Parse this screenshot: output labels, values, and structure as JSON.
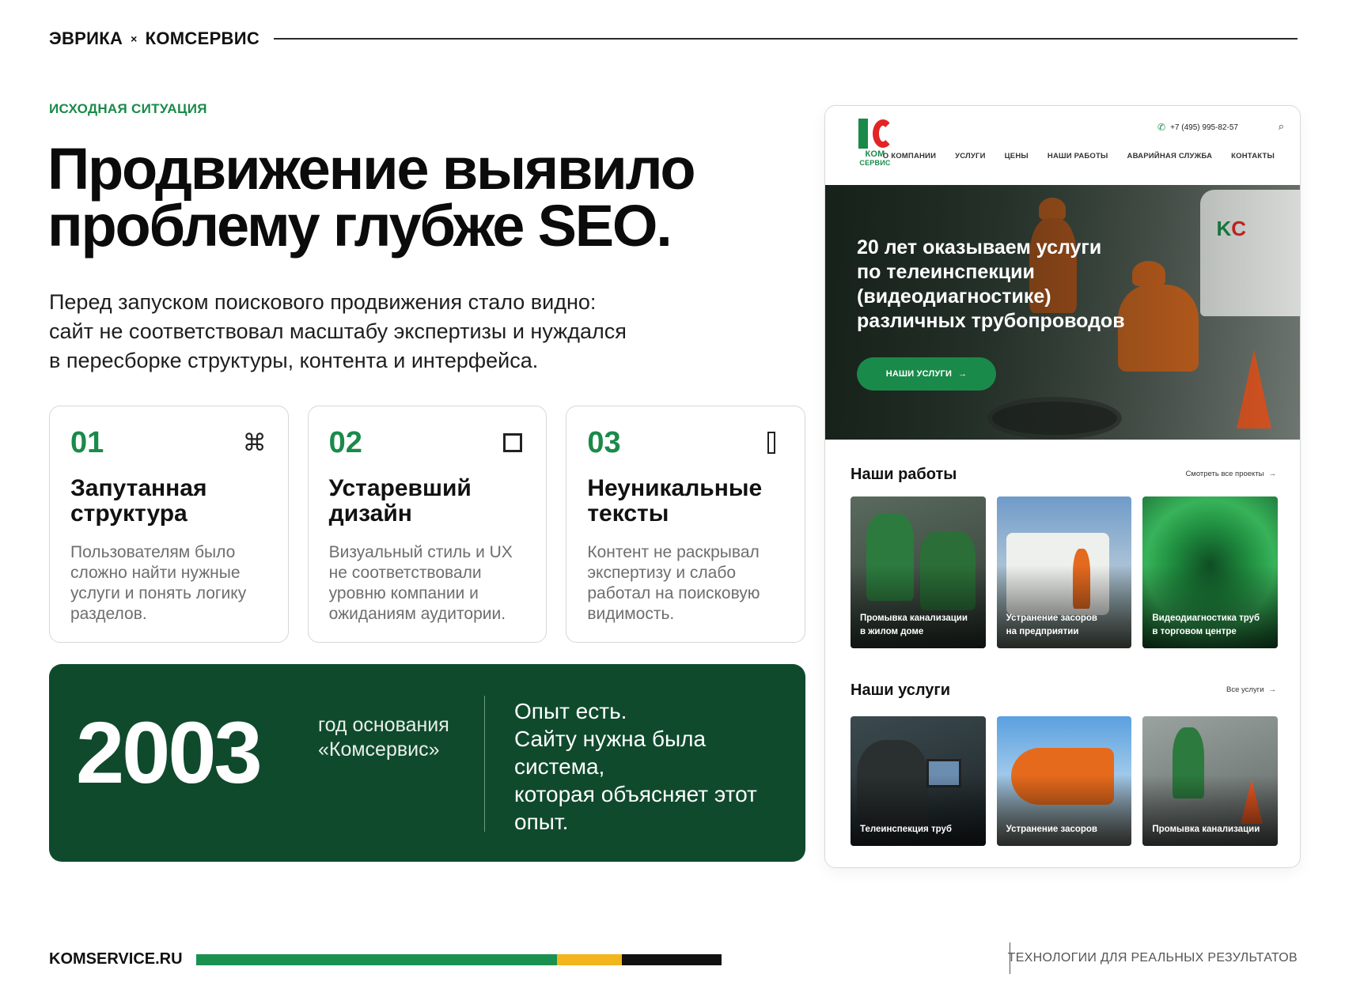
{
  "header": {
    "brand_left": "ЭВРИКА",
    "brand_sep": "×",
    "brand_right": "КОМСЕРВИС"
  },
  "intro": {
    "eyebrow": "ИСХОДНАЯ СИТУАЦИЯ",
    "headline_line1": "Продвижение выявило",
    "headline_line2": "проблему глубже SEO.",
    "lead_line1": "Перед запуском поискового продвижения стало видно:",
    "lead_line2": "сайт не соответствовал масштабу экспертизы и нуждался",
    "lead_line3": "в пересборке структуры, контента и интерфейса."
  },
  "cards": [
    {
      "num": "01",
      "icon": "command-icon",
      "title_line1": "Запутанная",
      "title_line2": "структура",
      "text": "Пользователям было сложно найти нужные услуги и понять логику разделов."
    },
    {
      "num": "02",
      "icon": "square-icon",
      "title_line1": "Устаревший",
      "title_line2": "дизайн",
      "text": "Визуальный стиль и UX не соответствовали уровню компании и ожиданиям аудитории."
    },
    {
      "num": "03",
      "icon": "bar-icon",
      "title_line1": "Неуникальные",
      "title_line2": "тексты",
      "text": "Контент не раскрывал экспертизу и слабо работал на поисковую видимость."
    }
  ],
  "stat": {
    "year": "2003",
    "label_line1": "год основания",
    "label_line2": "«Комсервис»",
    "quote_line1": "Опыт есть.",
    "quote_line2": "Сайту нужна была",
    "quote_line3": "система,",
    "quote_line4": "которая объясняет этот",
    "quote_line5": "опыт."
  },
  "footer": {
    "site": "KOMSERVICE.RU",
    "tagline": "ТЕХНОЛОГИИ ДЛЯ РЕАЛЬНЫХ РЕЗУЛЬТАТОВ",
    "bar_segments": [
      {
        "color": "#1a9150",
        "share": 0.686
      },
      {
        "color": "#f2b51c",
        "share": 0.124
      },
      {
        "color": "#111111",
        "share": 0.19
      }
    ]
  },
  "mockup": {
    "logo_line1": "КОМ",
    "logo_line2": "СЕРВИС",
    "phone": "+7 (495) 995-82-57",
    "nav": [
      "О КОМПАНИИ",
      "УСЛУГИ",
      "ЦЕНЫ",
      "НАШИ РАБОТЫ",
      "АВАРИЙНАЯ СЛУЖБА",
      "КОНТАКТЫ"
    ],
    "hero_title_line1": "20 лет оказываем услуги",
    "hero_title_line2": "по телеинспекции",
    "hero_title_line3": "(видеодиагностике)",
    "hero_title_line4": "различных трубопроводов",
    "hero_button": "НАШИ УСЛУГИ",
    "works_title": "Наши работы",
    "works_link": "Смотреть все проекты",
    "works": [
      {
        "line1": "Промывка канализации",
        "line2": "в жилом доме"
      },
      {
        "line1": "Устранение засоров",
        "line2": "на предприятии"
      },
      {
        "line1": "Видеодиагностика труб",
        "line2": "в торговом центре"
      }
    ],
    "services_title": "Наши услуги",
    "services_link": "Все услуги",
    "services": [
      "Телеинспекция труб",
      "Устранение засоров",
      "Промывка канализации"
    ],
    "colors": {
      "brand_green": "#1a8a4a",
      "brand_red": "#e32424",
      "dark_green": "#0f4a2c"
    }
  }
}
